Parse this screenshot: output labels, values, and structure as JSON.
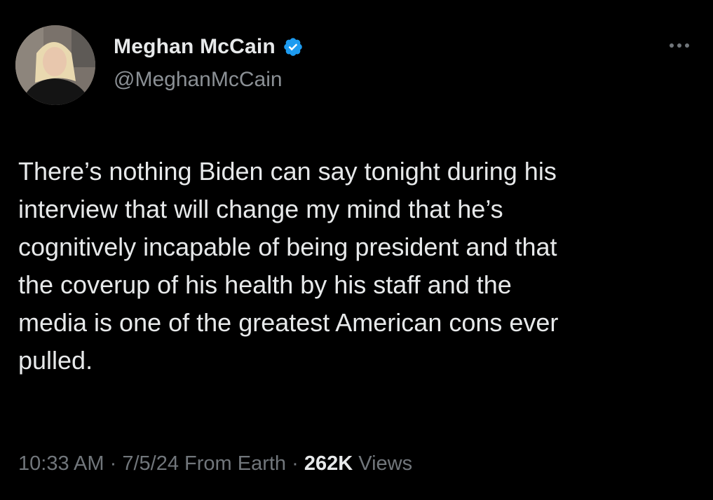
{
  "author": {
    "display_name": "Meghan McCain",
    "handle": "@MeghanMcCain",
    "verified": true
  },
  "icons": {
    "verified": "verified-badge-icon",
    "more": "more-options-icon",
    "avatar": "profile-avatar"
  },
  "tweet": {
    "lines": [
      "There’s nothing Biden can say tonight during his",
      "interview that will change my mind that he’s",
      "cognitively incapable of being president and that",
      "the coverup of his health by his staff and the",
      "media is one of the greatest American cons ever",
      "pulled."
    ]
  },
  "meta": {
    "time": "10:33 AM",
    "separator": "·",
    "date": "7/5/24",
    "source": "From Earth",
    "views_count": "262K",
    "views_label": "Views"
  },
  "colors": {
    "background": "#000000",
    "primary_text": "#e7e9ea",
    "secondary_text": "#71767b",
    "verified_blue": "#1d9bf0"
  }
}
